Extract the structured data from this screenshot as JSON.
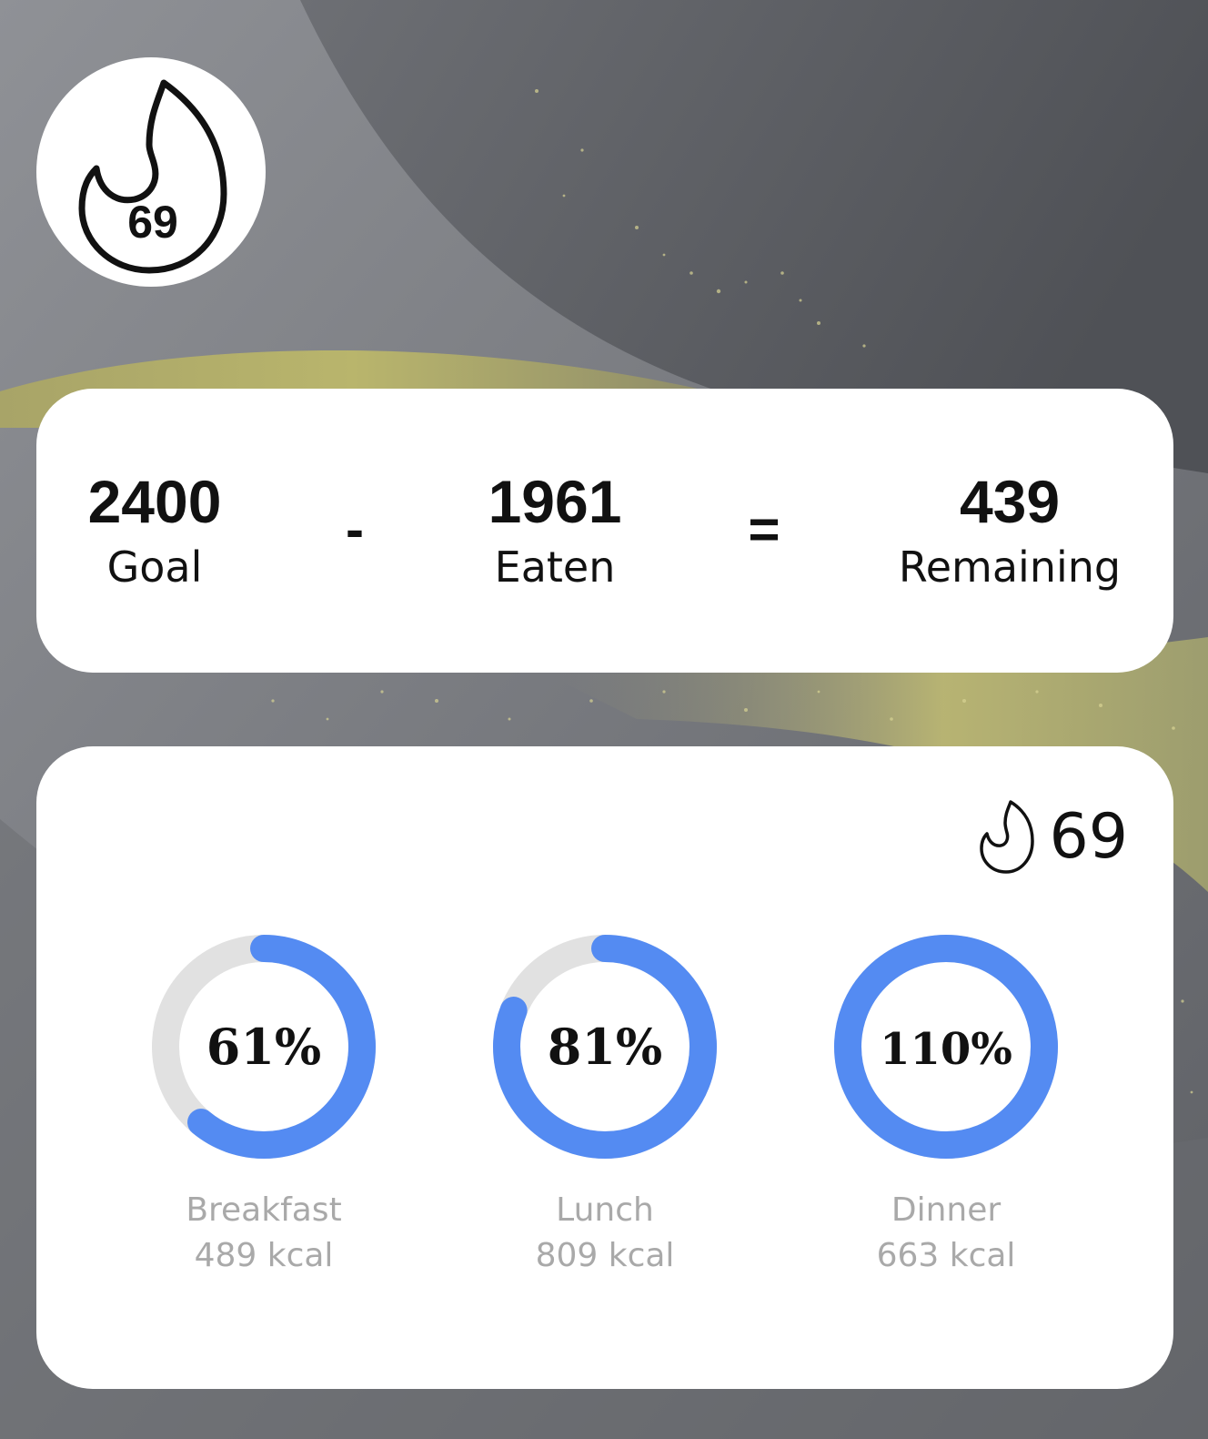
{
  "streak": {
    "value": "69"
  },
  "summary": {
    "goal": {
      "value": "2400",
      "label": "Goal"
    },
    "minus": "-",
    "eaten": {
      "value": "1961",
      "label": "Eaten"
    },
    "equals": "=",
    "remaining": {
      "value": "439",
      "label": "Remaining"
    }
  },
  "meals": [
    {
      "name": "Breakfast",
      "kcal": "489 kcal",
      "percent_label": "61%",
      "progress": 0.61
    },
    {
      "name": "Lunch",
      "kcal": "809 kcal",
      "percent_label": "81%",
      "progress": 0.81
    },
    {
      "name": "Dinner",
      "kcal": "663 kcal",
      "percent_label": "110%",
      "progress": 1.1
    }
  ],
  "colors": {
    "ring_fill": "#548bf2",
    "ring_track": "#e1e1e1",
    "card_bg": "#ffffff",
    "meal_text": "#a9a9a9"
  },
  "icons": {
    "streak_badge": "flame-icon",
    "streak_mini": "flame-icon"
  }
}
